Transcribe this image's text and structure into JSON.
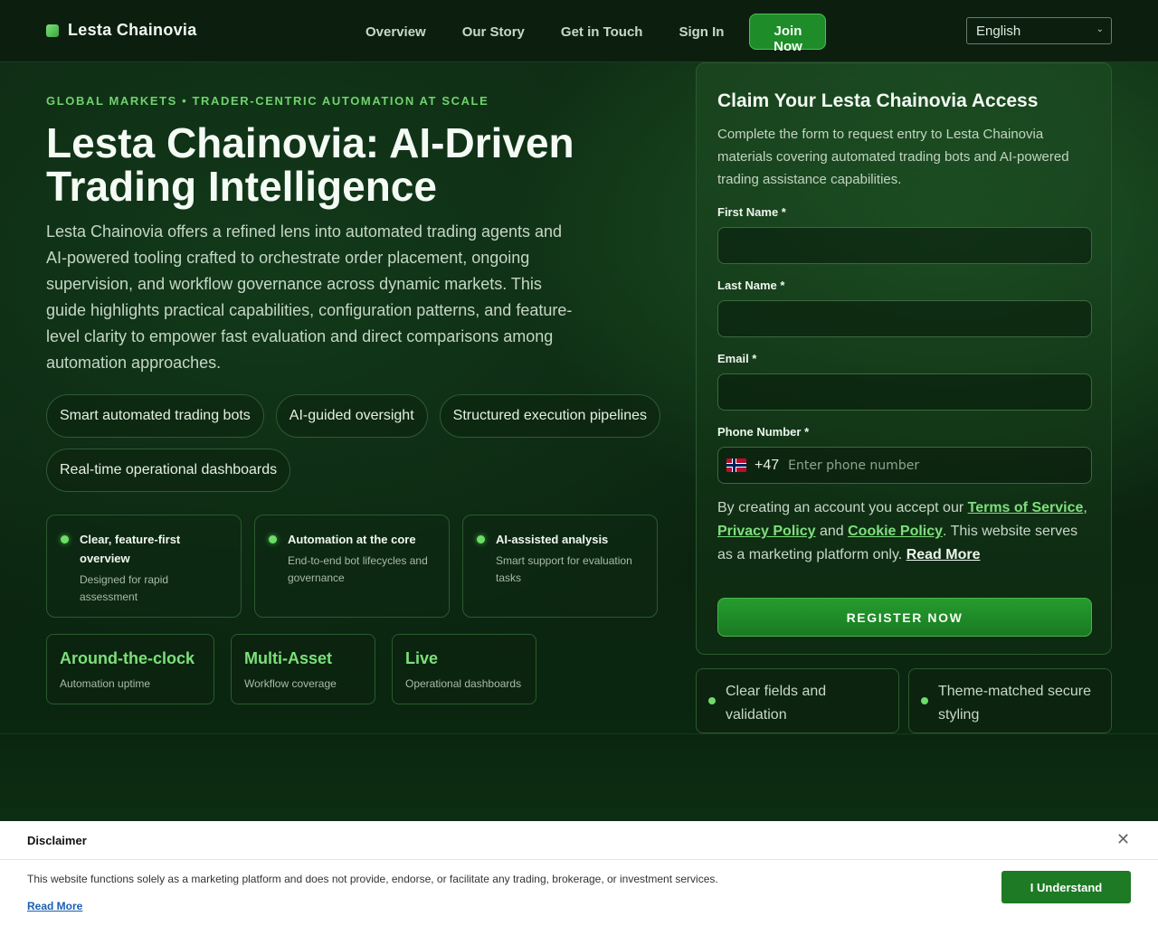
{
  "nav": {
    "brand": "Lesta Chainovia",
    "links": [
      "Overview",
      "Our Story",
      "Get in Touch",
      "Sign In"
    ],
    "join_label": "Join Now",
    "language": "English"
  },
  "hero": {
    "eyebrow": "GLOBAL MARKETS • TRADER-CENTRIC AUTOMATION AT SCALE",
    "title": "Lesta Chainovia: AI-Driven Trading Intelligence",
    "description": "Lesta Chainovia offers a refined lens into automated trading agents and AI-powered tooling crafted to orchestrate order placement, ongoing supervision, and workflow governance across dynamic markets. This guide highlights practical capabilities, configuration patterns, and feature-level clarity to empower fast evaluation and direct comparisons among automation approaches.",
    "chips": [
      "Smart automated trading bots",
      "AI-guided oversight",
      "Structured execution pipelines",
      "Real-time operational dashboards"
    ],
    "features": [
      {
        "title": "Clear, feature-first overview",
        "subtitle": "Designed for rapid assessment"
      },
      {
        "title": "Automation at the core",
        "subtitle": "End-to-end bot lifecycles and governance"
      },
      {
        "title": "AI-assisted analysis",
        "subtitle": "Smart support for evaluation tasks"
      }
    ],
    "stats": [
      {
        "value": "Around-the-clock",
        "label": "Automation uptime"
      },
      {
        "value": "Multi-Asset",
        "label": "Workflow coverage"
      },
      {
        "value": "Live",
        "label": "Operational dashboards"
      }
    ]
  },
  "form": {
    "title": "Claim Your Lesta Chainovia Access",
    "description": "Complete the form to request entry to Lesta Chainovia materials covering automated trading bots and AI-powered trading assistance capabilities.",
    "first_name_label": "First Name *",
    "last_name_label": "Last Name *",
    "email_label": "Email *",
    "phone_label": "Phone Number *",
    "dial_code": "+47",
    "phone_placeholder": "Enter phone number",
    "terms_prefix": "By creating an account you accept our ",
    "terms_link": "Terms of Service",
    "comma": ",",
    "privacy_link": "Privacy Policy",
    "and": " and ",
    "cookie_link": "Cookie Policy",
    "terms_suffix": ". This website serves as a marketing platform only. ",
    "read_more": "Read More",
    "register_label": "REGISTER NOW"
  },
  "assurances": [
    "Clear fields and validation",
    "Theme-matched secure styling"
  ],
  "disclaimer": {
    "title": "Disclaimer",
    "close": "✕",
    "body": "This website functions solely as a marketing platform and does not provide, endorse, or facilitate any trading, brokerage, or investment services.",
    "read_more": "Read More",
    "button": "I Understand"
  },
  "colors": {
    "accent": "#6fd36d",
    "button": "#1f8c2a",
    "background": "#0f2a13"
  }
}
